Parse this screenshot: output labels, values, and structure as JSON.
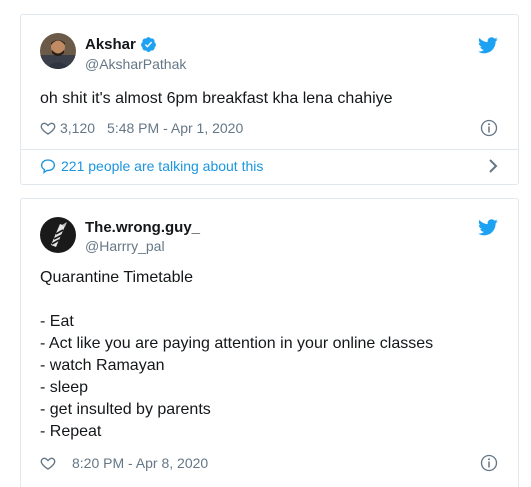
{
  "tweets": [
    {
      "display_name": "Akshar",
      "handle": "@AksharPathak",
      "verified": true,
      "text_lines": [
        "oh shit it's almost 6pm breakfast kha lena chahiye"
      ],
      "likes": "3,120",
      "timestamp": "5:48 PM - Apr 1, 2020",
      "conversation": "221 people are talking about this"
    },
    {
      "display_name": "The.wrong.guy_",
      "handle": "@Harrry_pal",
      "verified": false,
      "text_lines": [
        "Quarantine Timetable",
        "",
        "- Eat",
        "- Act like you are paying attention in your online classes",
        "- watch Ramayan",
        "- sleep",
        "- get insulted by parents",
        "- Repeat"
      ],
      "timestamp": "8:20 PM - Apr 8, 2020"
    }
  ],
  "colors": {
    "twitter_blue": "#1da1f2",
    "link_blue": "#1b95e0",
    "muted": "#657786",
    "border": "#e1e8ed"
  },
  "icons": [
    "verified-badge-icon",
    "twitter-bird-icon",
    "heart-icon",
    "info-icon",
    "speech-bubble-icon",
    "chevron-right-icon"
  ]
}
